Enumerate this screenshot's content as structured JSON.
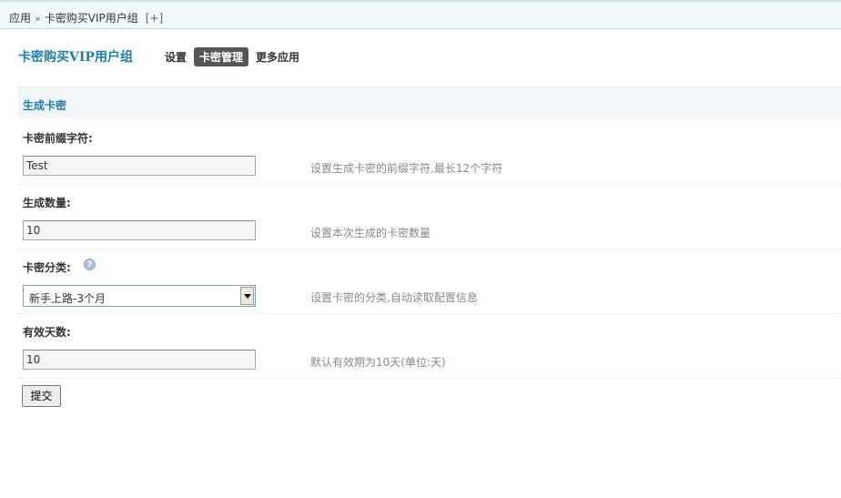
{
  "breadcrumb": {
    "root": "应用",
    "separator": "»",
    "current": "卡密购买VIP用户组",
    "add_link": "[+]"
  },
  "header": {
    "app_title": "卡密购买VIP用户组",
    "tabs": [
      {
        "label": "设置",
        "active": false
      },
      {
        "label": "卡密管理",
        "active": true
      },
      {
        "label": "更多应用",
        "active": false
      }
    ]
  },
  "section": {
    "title": "生成卡密"
  },
  "form": {
    "prefix": {
      "label": "卡密前缀字符:",
      "value": "Test",
      "hint": "设置生成卡密的前缀字符,最长12个字符"
    },
    "count": {
      "label": "生成数量:",
      "value": "10",
      "hint": "设置本次生成的卡密数量"
    },
    "category": {
      "label": "卡密分类:",
      "help_icon": "?",
      "selected": "新手上路-3个月",
      "hint": "设置卡密的分类,自动读取配置信息"
    },
    "valid_days": {
      "label": "有效天数:",
      "value": "10",
      "hint": "默认有效期为10天(单位:天)"
    },
    "submit_label": "提交"
  },
  "colors": {
    "accent": "#1d7fa6",
    "section_bg": "#f0f6fa",
    "active_tab_bg": "#555555",
    "hint_text": "#888888"
  }
}
